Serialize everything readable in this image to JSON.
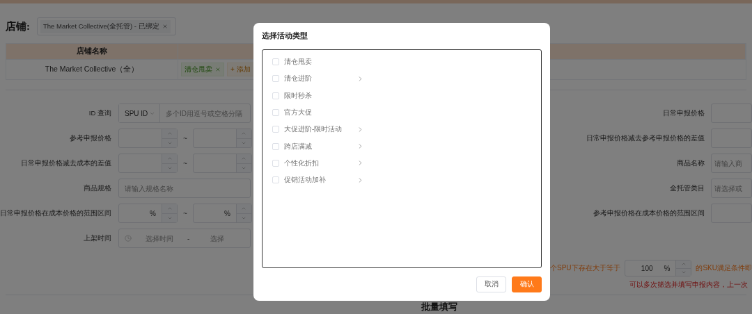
{
  "store": {
    "label": "店铺:",
    "tag": "The Market Collective(全托管) - 已绑定"
  },
  "store_table": {
    "columns": [
      "店铺名称"
    ],
    "rows": [
      {
        "name": "The Market Collective（全）",
        "activities": [
          "清仓甩卖"
        ],
        "add_label": "+ 添加"
      }
    ]
  },
  "filters_left": [
    {
      "label": "ID 查询",
      "kind": "id",
      "select": "SPU ID",
      "placeholder": "多个ID用逗号或空格分隔"
    },
    {
      "label": "参考申报价格",
      "kind": "range",
      "separator": "~"
    },
    {
      "label": "日常申报价格减去成本的差值",
      "kind": "range",
      "separator": "~"
    },
    {
      "label": "商品规格",
      "kind": "text",
      "placeholder": "请输入规格名称"
    },
    {
      "label": "日常申报价格在成本价格的范围区间",
      "kind": "percent_range",
      "units": [
        "%",
        "%"
      ],
      "separator": "~"
    },
    {
      "label": "上架时间",
      "kind": "date_range",
      "start_placeholder": "选择时间",
      "separator": "-",
      "end_placeholder": "选择"
    }
  ],
  "filters_right": [
    {
      "label": "日常申报价格",
      "kind": "blank"
    },
    {
      "label": "日常申报价格减去参考申报价格的差值",
      "kind": "blank"
    },
    {
      "label": "商品名称",
      "kind": "text",
      "placeholder": "请输入商"
    },
    {
      "label": "全托管类目",
      "kind": "text",
      "placeholder": "请选择或"
    },
    {
      "label": "参考申报价格在成本价格的范围区间",
      "kind": "blank"
    }
  ],
  "sku_rule": {
    "prefix": "个SPU下存在大于等于",
    "value": "100",
    "unit": "%",
    "suffix": "的SKU满足条件即"
  },
  "note": "可以多次筛选并填写申报内容，上一次",
  "section_title": "批量填写",
  "dialog": {
    "title": "选择活动类型",
    "options": [
      {
        "label": "清仓甩卖",
        "checked": false,
        "has_children": false
      },
      {
        "label": "清仓进阶",
        "checked": false,
        "has_children": true
      },
      {
        "label": "限时秒杀",
        "checked": false,
        "has_children": false
      },
      {
        "label": "官方大促",
        "checked": false,
        "has_children": false
      },
      {
        "label": "大促进阶-限时活动",
        "checked": false,
        "has_children": true
      },
      {
        "label": "跨店满减",
        "checked": false,
        "has_children": true
      },
      {
        "label": "个性化折扣",
        "checked": false,
        "has_children": true
      },
      {
        "label": "促销活动加补",
        "checked": false,
        "has_children": true
      }
    ],
    "buttons": [
      {
        "label": "取消",
        "kind": "default"
      },
      {
        "label": "确认",
        "kind": "primary"
      }
    ]
  }
}
